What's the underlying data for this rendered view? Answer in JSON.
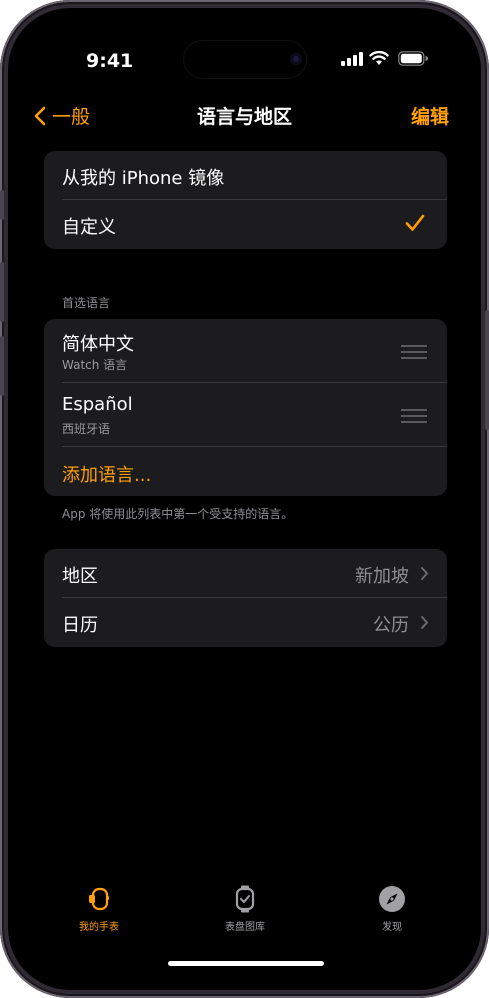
{
  "status": {
    "time": "9:41"
  },
  "nav": {
    "back_label": "一般",
    "title": "语言与地区",
    "edit_label": "编辑"
  },
  "mode_group": {
    "items": [
      {
        "label": "从我的 iPhone 镜像"
      },
      {
        "label": "自定义",
        "checked": true
      }
    ]
  },
  "preferred_languages": {
    "header": "首选语言",
    "languages": [
      {
        "name": "简体中文",
        "subtitle": "Watch 语言"
      },
      {
        "name": "Español",
        "subtitle": "西班牙语"
      }
    ],
    "add_label": "添加语言...",
    "footer": "App 将使用此列表中第一个受支持的语言。"
  },
  "region_group": {
    "items": [
      {
        "label": "地区",
        "value": "新加坡"
      },
      {
        "label": "日历",
        "value": "公历"
      }
    ]
  },
  "tabbar": {
    "tabs": [
      {
        "label": "我的手表",
        "icon": "watch-icon",
        "active": true
      },
      {
        "label": "表盘图库",
        "icon": "watch-face-gallery-icon",
        "active": false
      },
      {
        "label": "发现",
        "icon": "compass-icon",
        "active": false
      }
    ]
  },
  "colors": {
    "accent": "#ff9f0a",
    "background": "#000000",
    "cell": "#1c1c1e",
    "secondary_text": "#8e8e93"
  }
}
